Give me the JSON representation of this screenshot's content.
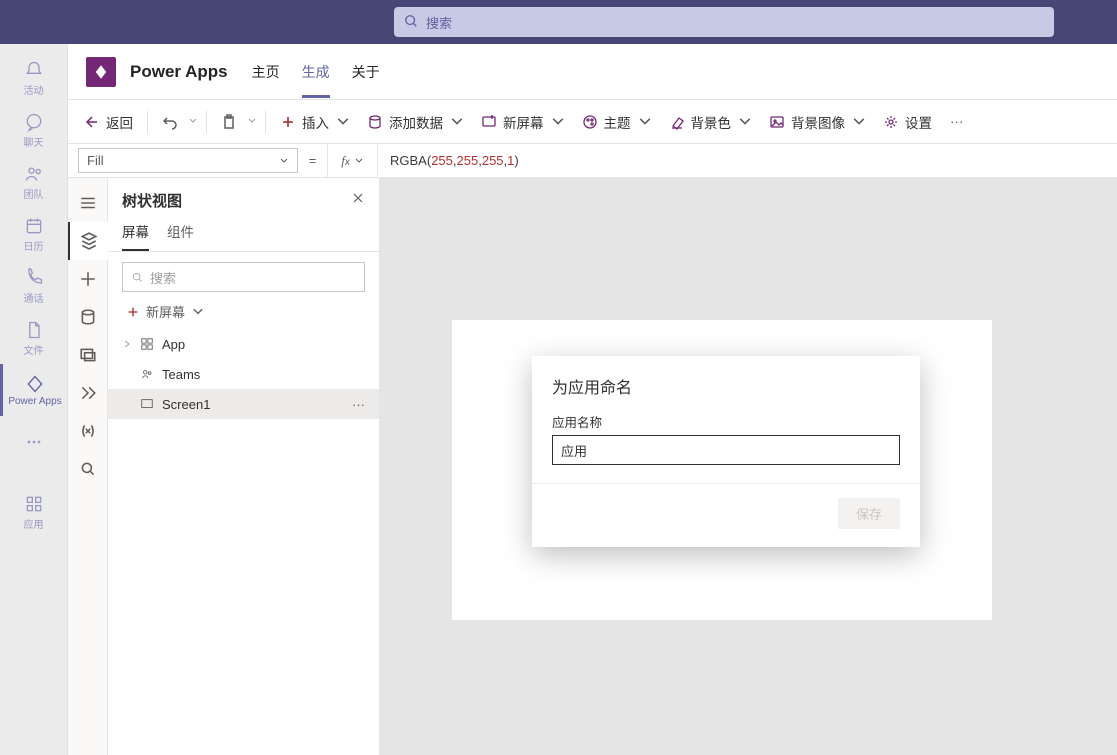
{
  "search": {
    "placeholder": "搜索"
  },
  "rail": {
    "activity": "活动",
    "chat": "聊天",
    "team": "团队",
    "calendar": "日历",
    "calls": "通话",
    "files": "文件",
    "powerapps": "Power Apps",
    "apps": "应用"
  },
  "appHeader": {
    "title": "Power Apps",
    "tabs": {
      "home": "主页",
      "build": "生成",
      "about": "关于"
    }
  },
  "toolbar": {
    "back": "返回",
    "insert": "插入",
    "addData": "添加数据",
    "newScreen": "新屏幕",
    "theme": "主题",
    "bgColor": "背景色",
    "bgImage": "背景图像",
    "settings": "设置"
  },
  "formula": {
    "property": "Fill",
    "fn": "RGBA",
    "args": [
      "255",
      "255",
      "255",
      "1"
    ]
  },
  "tree": {
    "title": "树状视图",
    "tabs": {
      "screens": "屏幕",
      "components": "组件"
    },
    "searchPlaceholder": "搜索",
    "newScreen": "新屏幕",
    "nodes": {
      "app": "App",
      "teams": "Teams",
      "screen1": "Screen1"
    }
  },
  "modal": {
    "title": "为应用命名",
    "fieldLabel": "应用名称",
    "fieldValue": "应用",
    "save": "保存"
  }
}
